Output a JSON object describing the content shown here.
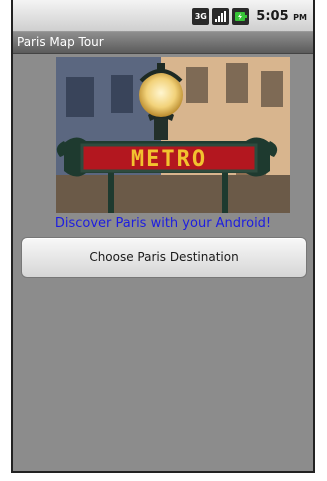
{
  "status_bar": {
    "network_badge": "3G",
    "time": "5:05",
    "ampm": "PM"
  },
  "title_bar": {
    "title": "Paris Map Tour"
  },
  "main": {
    "photo_sign_text": "METRO",
    "subtitle": "Discover Paris with your Android!",
    "choose_button_label": "Choose Paris Destination"
  },
  "colors": {
    "subtitle": "#1d1de0",
    "background": "#8c8c8c",
    "sign_red": "#b3171f",
    "sign_letters": "#f2c32f"
  }
}
